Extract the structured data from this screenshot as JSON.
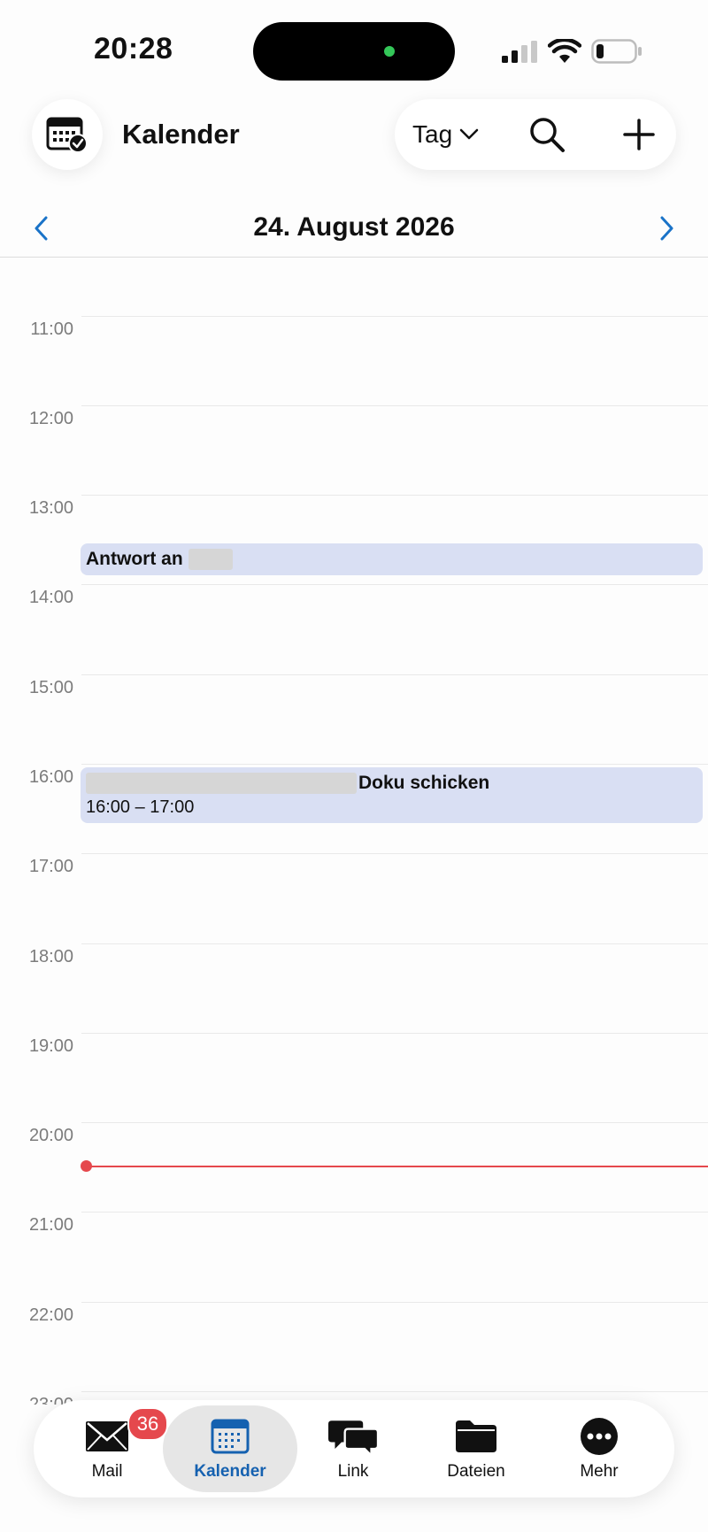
{
  "status_bar": {
    "time": "20:28"
  },
  "header": {
    "title": "Kalender",
    "view_select": "Tag"
  },
  "date_nav": {
    "date": "24. August 2026"
  },
  "timeline": {
    "hours": [
      "11:00",
      "12:00",
      "13:00",
      "14:00",
      "15:00",
      "16:00",
      "17:00",
      "18:00",
      "19:00",
      "20:00",
      "21:00",
      "22:00",
      "23:00"
    ],
    "events": [
      {
        "title": "Antwort an",
        "time": ""
      },
      {
        "title": "Doku schicken",
        "time": "16:00 – 17:00"
      }
    ]
  },
  "tabs": [
    {
      "label": "Mail",
      "badge": "36",
      "icon": "mail-icon"
    },
    {
      "label": "Kalender",
      "icon": "calendar-icon",
      "active": true
    },
    {
      "label": "Link",
      "icon": "chat-bubbles-icon"
    },
    {
      "label": "Dateien",
      "icon": "folder-icon"
    },
    {
      "label": "Mehr",
      "icon": "more-icon"
    }
  ],
  "colors": {
    "accent": "#1a73c8",
    "event_bg": "#d9dff3",
    "now_line": "#e5484d",
    "badge": "#e5484d"
  }
}
